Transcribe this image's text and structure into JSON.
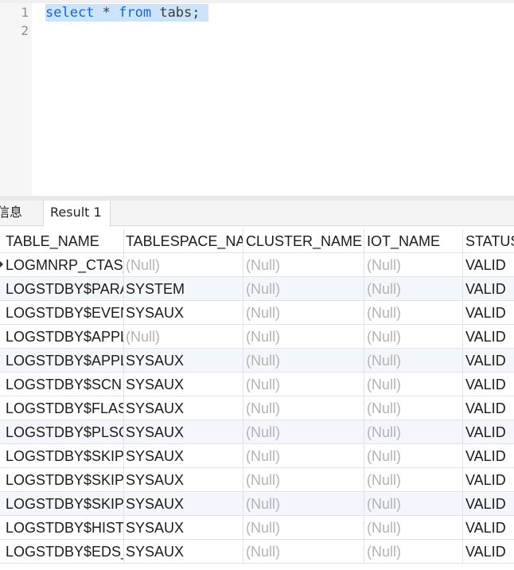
{
  "editor": {
    "line_numbers": [
      "1",
      "2"
    ],
    "code": {
      "kw1": "select",
      "mid": " * ",
      "kw2": "from",
      "rest": " tabs;"
    }
  },
  "tabs": {
    "info": "信息",
    "result": "Result 1"
  },
  "grid": {
    "columns": [
      "TABLE_NAME",
      "TABLESPACE_NA",
      "CLUSTER_NAME",
      "IOT_NAME",
      "STATUS"
    ],
    "rows": [
      [
        "LOGMNRP_CTAS_",
        "(Null)",
        "(Null)",
        "(Null)",
        "VALID"
      ],
      [
        "LOGSTDBY$PARA",
        "SYSTEM",
        "(Null)",
        "(Null)",
        "VALID"
      ],
      [
        "LOGSTDBY$EVEN",
        "SYSAUX",
        "(Null)",
        "(Null)",
        "VALID"
      ],
      [
        "LOGSTDBY$APPL",
        "(Null)",
        "(Null)",
        "(Null)",
        "VALID"
      ],
      [
        "LOGSTDBY$APPL",
        "SYSAUX",
        "(Null)",
        "(Null)",
        "VALID"
      ],
      [
        "LOGSTDBY$SCN",
        "SYSAUX",
        "(Null)",
        "(Null)",
        "VALID"
      ],
      [
        "LOGSTDBY$FLAS",
        "SYSAUX",
        "(Null)",
        "(Null)",
        "VALID"
      ],
      [
        "LOGSTDBY$PLSQ",
        "SYSAUX",
        "(Null)",
        "(Null)",
        "VALID"
      ],
      [
        "LOGSTDBY$SKIP_",
        "SYSAUX",
        "(Null)",
        "(Null)",
        "VALID"
      ],
      [
        "LOGSTDBY$SKIP",
        "SYSAUX",
        "(Null)",
        "(Null)",
        "VALID"
      ],
      [
        "LOGSTDBY$SKIP_",
        "SYSAUX",
        "(Null)",
        "(Null)",
        "VALID"
      ],
      [
        "LOGSTDBY$HIST(",
        "SYSAUX",
        "(Null)",
        "(Null)",
        "VALID"
      ],
      [
        "LOGSTDBY$EDS_",
        "SYSAUX",
        "(Null)",
        "(Null)",
        "VALID"
      ]
    ],
    "alt_rows": [
      1,
      4,
      7,
      10
    ],
    "null_text": "(Null)"
  }
}
